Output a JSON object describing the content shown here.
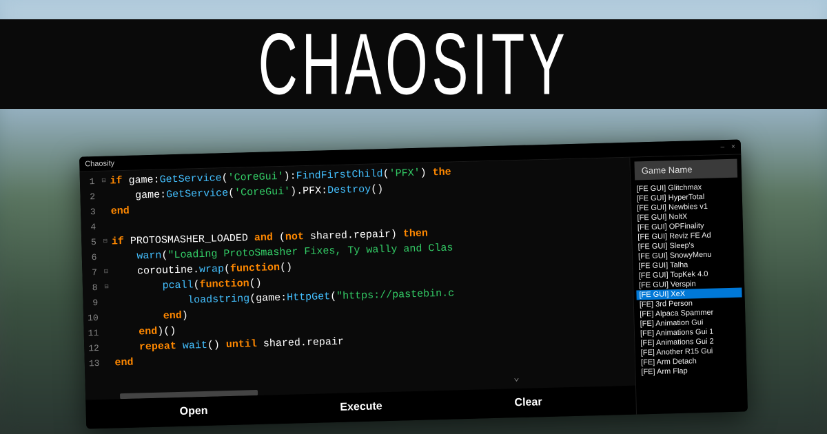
{
  "banner": {
    "title": "CHAOSITY"
  },
  "window": {
    "title": "Chaosity",
    "minimize": "–",
    "close": "×"
  },
  "editor": {
    "lines": [
      {
        "n": 1,
        "fold": "⊟",
        "html": "<span class='kw'>if</span> <span class='var'>game</span><span class='op'>:</span><span class='fn'>GetService</span><span class='op'>(</span><span class='str'>'CoreGui'</span><span class='op'>):</span><span class='fn'>FindFirstChild</span><span class='op'>(</span><span class='str'>'PFX'</span><span class='op'>)</span> <span class='kw'>the</span>"
      },
      {
        "n": 2,
        "fold": "",
        "html": "    <span class='var'>game</span><span class='op'>:</span><span class='fn'>GetService</span><span class='op'>(</span><span class='str'>'CoreGui'</span><span class='op'>).</span><span class='var'>PFX</span><span class='op'>:</span><span class='fn'>Destroy</span><span class='op'>()</span>"
      },
      {
        "n": 3,
        "fold": "",
        "html": "<span class='kw'>end</span>"
      },
      {
        "n": 4,
        "fold": "",
        "html": ""
      },
      {
        "n": 5,
        "fold": "⊟",
        "html": "<span class='kw'>if</span> <span class='var'>PROTOSMASHER_LOADED</span> <span class='kw'>and</span> <span class='op'>(</span><span class='kw'>not</span> <span class='var'>shared</span><span class='op'>.</span><span class='var'>repair</span><span class='op'>)</span> <span class='kw'>then</span>"
      },
      {
        "n": 6,
        "fold": "",
        "html": "    <span class='fn'>warn</span><span class='op'>(</span><span class='str'>\"Loading ProtoSmasher Fixes, Ty wally and Clas</span>"
      },
      {
        "n": 7,
        "fold": "⊟",
        "html": "    <span class='var'>coroutine</span><span class='op'>.</span><span class='fn'>wrap</span><span class='op'>(</span><span class='kw'>function</span><span class='op'>()</span>"
      },
      {
        "n": 8,
        "fold": "⊟",
        "html": "        <span class='fn'>pcall</span><span class='op'>(</span><span class='kw'>function</span><span class='op'>()</span>"
      },
      {
        "n": 9,
        "fold": "",
        "html": "            <span class='fn'>loadstring</span><span class='op'>(</span><span class='var'>game</span><span class='op'>:</span><span class='fn'>HttpGet</span><span class='op'>(</span><span class='str'>\"https://pastebin.c</span>"
      },
      {
        "n": 10,
        "fold": "",
        "html": "        <span class='kw'>end</span><span class='op'>)</span>"
      },
      {
        "n": 11,
        "fold": "",
        "html": "    <span class='kw'>end</span><span class='op'>)()</span>"
      },
      {
        "n": 12,
        "fold": "",
        "html": "    <span class='kw'>repeat</span> <span class='fn'>wait</span><span class='op'>()</span> <span class='kw'>until</span> <span class='var'>shared</span><span class='op'>.</span><span class='var'>repair</span>"
      },
      {
        "n": 13,
        "fold": "",
        "html": "<span class='kw'>end</span>"
      }
    ]
  },
  "sidebar": {
    "header": "Game Name",
    "items": [
      {
        "label": "[FE GUI] Glitchmax",
        "selected": false
      },
      {
        "label": "[FE GUI] HyperTotal",
        "selected": false
      },
      {
        "label": "[FE GUI] Newbies v1",
        "selected": false
      },
      {
        "label": "[FE GUI] NoltX",
        "selected": false
      },
      {
        "label": "[FE GUI] OPFinality",
        "selected": false
      },
      {
        "label": "[FE GUI] Reviz FE Ad",
        "selected": false
      },
      {
        "label": "[FE GUI] Sleep's",
        "selected": false
      },
      {
        "label": "[FE GUI] SnowyMenu",
        "selected": false
      },
      {
        "label": "[FE GUI] Talha",
        "selected": false
      },
      {
        "label": "[FE GUI] TopKek 4.0",
        "selected": false
      },
      {
        "label": "[FE GUI] Verspin",
        "selected": false
      },
      {
        "label": "[FE GUI] XeX",
        "selected": true
      },
      {
        "label": "[FE] 3rd Person",
        "selected": false
      },
      {
        "label": "[FE] Alpaca Spammer",
        "selected": false
      },
      {
        "label": "[FE] Animation Gui",
        "selected": false
      },
      {
        "label": "[FE] Animations Gui 1",
        "selected": false
      },
      {
        "label": "[FE] Animations Gui 2",
        "selected": false
      },
      {
        "label": "[FE] Another R15 Gui",
        "selected": false
      },
      {
        "label": "[FE] Arm Detach",
        "selected": false
      },
      {
        "label": "[FE] Arm Flap",
        "selected": false
      }
    ]
  },
  "buttons": {
    "open": "Open",
    "execute": "Execute",
    "clear": "Clear"
  },
  "scroll_arrow": "⌄"
}
